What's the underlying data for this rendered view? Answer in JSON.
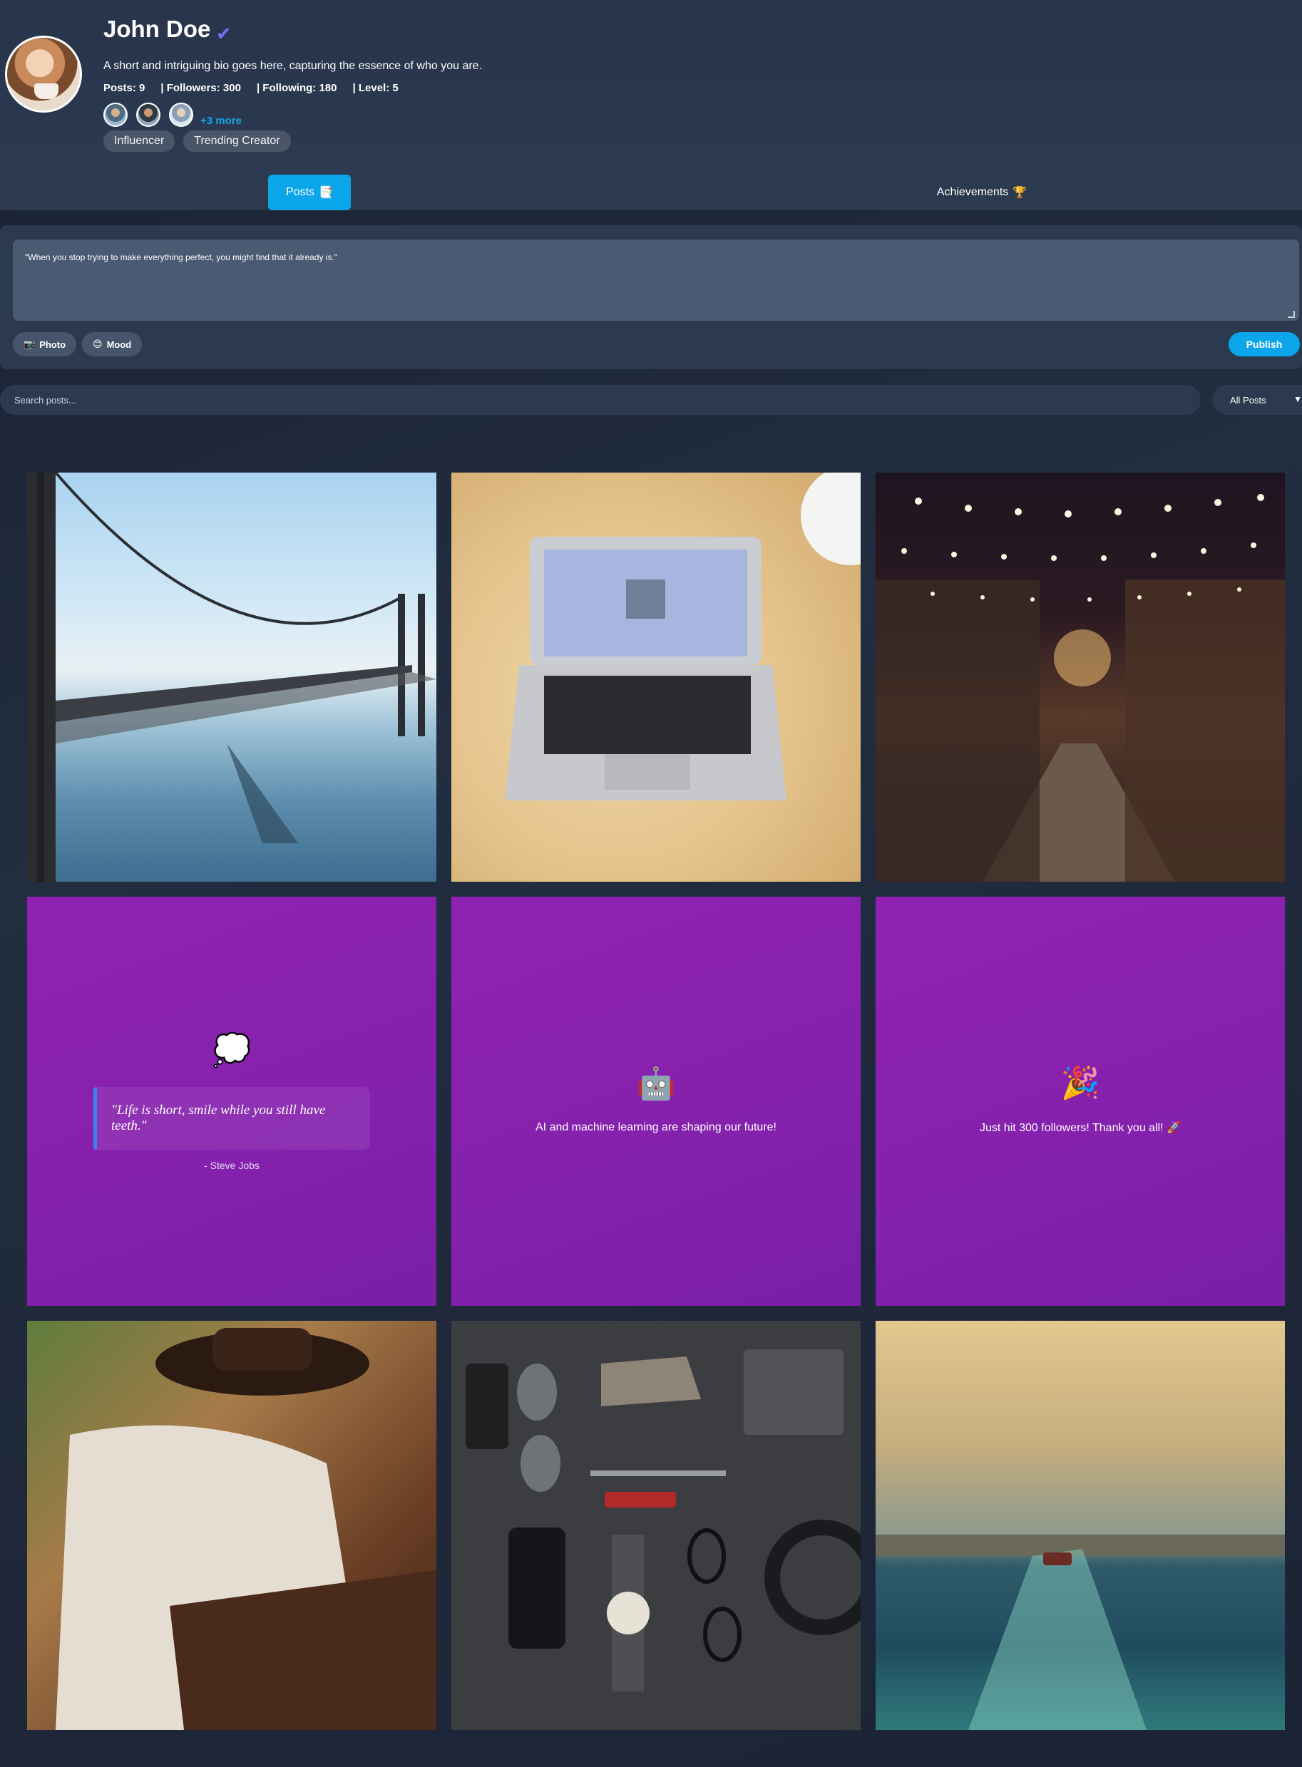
{
  "profile": {
    "name": "John Doe",
    "verified_icon": "✔",
    "bio": "A short and intriguing bio goes here, capturing the essence of who you are.",
    "stats": [
      "Posts: 9",
      "| Followers: 300",
      "| Following: 180",
      "| Level: 5"
    ],
    "more_followers": "+3 more",
    "badges": [
      "Influencer",
      "Trending Creator"
    ]
  },
  "tabs": {
    "posts_label": "Posts",
    "posts_icon": "📑",
    "achievements_label": "Achievements",
    "achievements_icon": "🏆"
  },
  "composer": {
    "text": "\"When you stop trying to make everything perfect, you might find that it already is.\"",
    "photo_icon": "📷",
    "photo_label": "Photo",
    "mood_icon": "😊",
    "mood_label": "Mood",
    "publish_label": "Publish"
  },
  "search": {
    "placeholder": "Search posts...",
    "filter_value": "All Posts"
  },
  "posts": {
    "quote": {
      "icon": "💭",
      "text": "\"Life is short, smile while you still have teeth.\"",
      "author": "- Steve Jobs"
    },
    "ai": {
      "icon": "🤖",
      "text": "AI and machine learning are shaping our future!"
    },
    "followers": {
      "icon": "🎉",
      "text": "Just hit 300 followers! Thank you all! 🚀"
    }
  },
  "colors": {
    "accent": "#0ba5e9",
    "verified": "#7b6cf6",
    "purple_tile": "#8a22ae"
  }
}
